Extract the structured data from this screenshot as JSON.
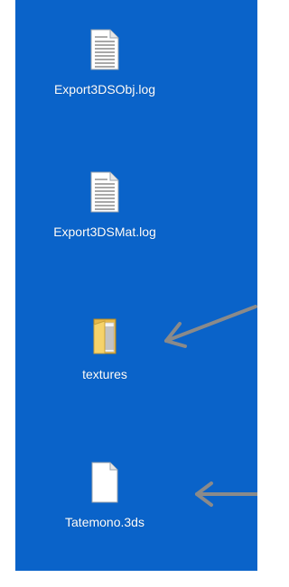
{
  "desktop": {
    "background_color": "#0a63c9",
    "items": [
      {
        "label": "Export3DSObj.log",
        "icon": "text-document-icon"
      },
      {
        "label": "Export3DSMat.log",
        "icon": "text-document-icon"
      },
      {
        "label": "textures",
        "icon": "folder-icon"
      },
      {
        "label": "Tatemono.3ds",
        "icon": "blank-file-icon"
      }
    ]
  },
  "annotations": {
    "arrow_color": "#8a8a8a",
    "arrows": [
      {
        "points_to": "textures",
        "icon": "arrow-icon"
      },
      {
        "points_to": "Tatemono.3ds",
        "icon": "arrow-icon"
      }
    ]
  }
}
